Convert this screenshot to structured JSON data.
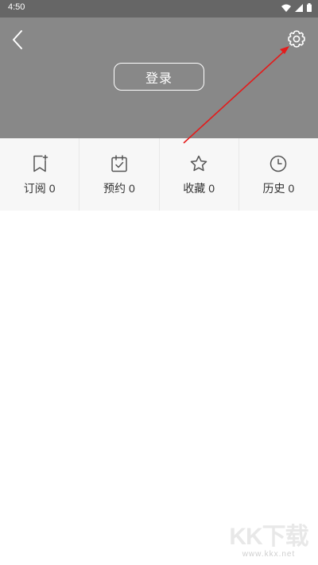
{
  "status_bar": {
    "time": "4:50"
  },
  "header": {
    "login_label": "登录"
  },
  "stats": [
    {
      "label": "订阅",
      "count": "0",
      "icon": "bookmark-add-icon"
    },
    {
      "label": "预约",
      "count": "0",
      "icon": "calendar-check-icon"
    },
    {
      "label": "收藏",
      "count": "0",
      "icon": "star-icon"
    },
    {
      "label": "历史",
      "count": "0",
      "icon": "clock-icon"
    }
  ],
  "watermark": {
    "logo": "KK下载",
    "url": "www.kkx.net"
  },
  "colors": {
    "header_bg": "#888888",
    "status_bar_bg": "#666666",
    "stats_bg": "#f7f7f7",
    "annotation_arrow": "#e41b1b"
  }
}
